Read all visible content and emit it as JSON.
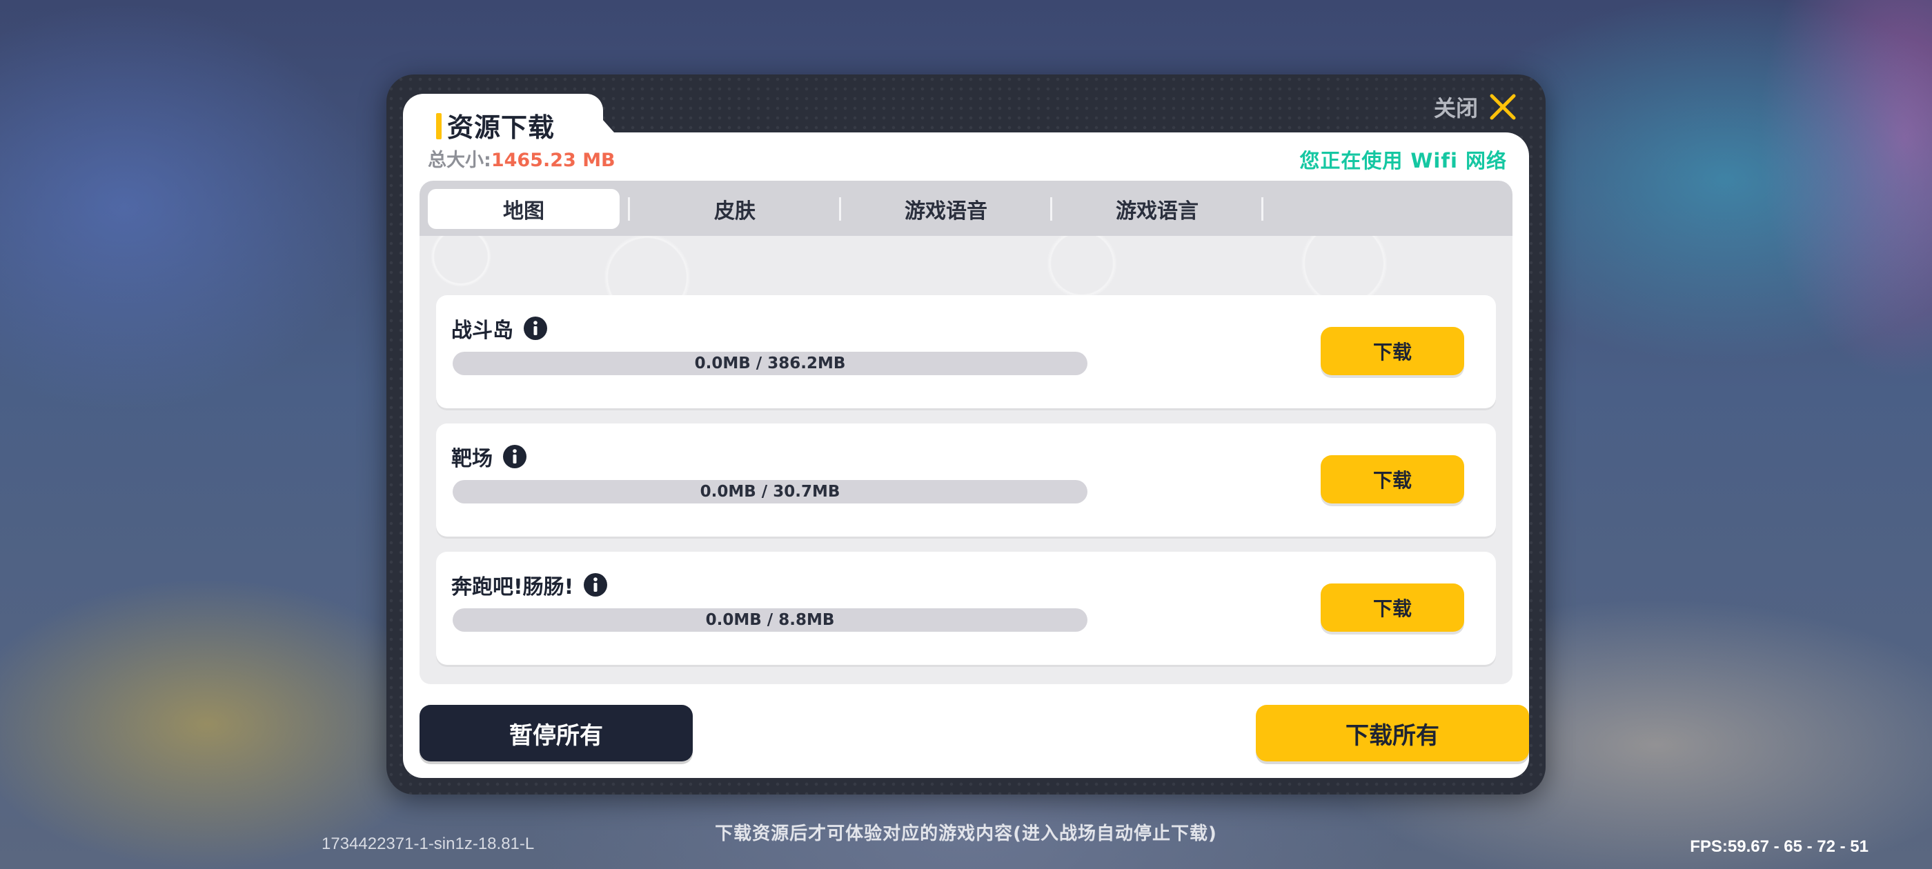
{
  "dialog": {
    "title": "资源下载",
    "total_size_label": "总大小:",
    "total_size_value": "1465.23 MB",
    "close_label": "关闭",
    "network_status": "您正在使用 Wifi 网络"
  },
  "tabs": [
    {
      "label": "地图",
      "active": true
    },
    {
      "label": "皮肤",
      "active": false
    },
    {
      "label": "游戏语音",
      "active": false
    },
    {
      "label": "游戏语言",
      "active": false
    }
  ],
  "items": [
    {
      "name": "战斗岛",
      "progress_text": "0.0MB / 386.2MB",
      "progress_fraction": 0,
      "button_label": "下载"
    },
    {
      "name": "靶场",
      "progress_text": "0.0MB / 30.7MB",
      "progress_fraction": 0,
      "button_label": "下载"
    },
    {
      "name": "奔跑吧!肠肠!",
      "progress_text": "0.0MB / 8.8MB",
      "progress_fraction": 0,
      "button_label": "下载"
    }
  ],
  "actions": {
    "pause_all": "暂停所有",
    "download_all": "下载所有"
  },
  "footer": {
    "hint": "下载资源后才可体验对应的游戏内容(进入战场自动停止下载)",
    "build_id": "1734422371-1-sin1z-18.81-L",
    "fps": "FPS:59.67 - 65 - 72 - 51"
  },
  "colors": {
    "accent": "#ffc20a",
    "network_ok": "#15c7a2",
    "size_value": "#f26a4f",
    "dark_button": "#1e2436"
  },
  "icons": {
    "close": "close-icon",
    "info": "info-icon"
  }
}
